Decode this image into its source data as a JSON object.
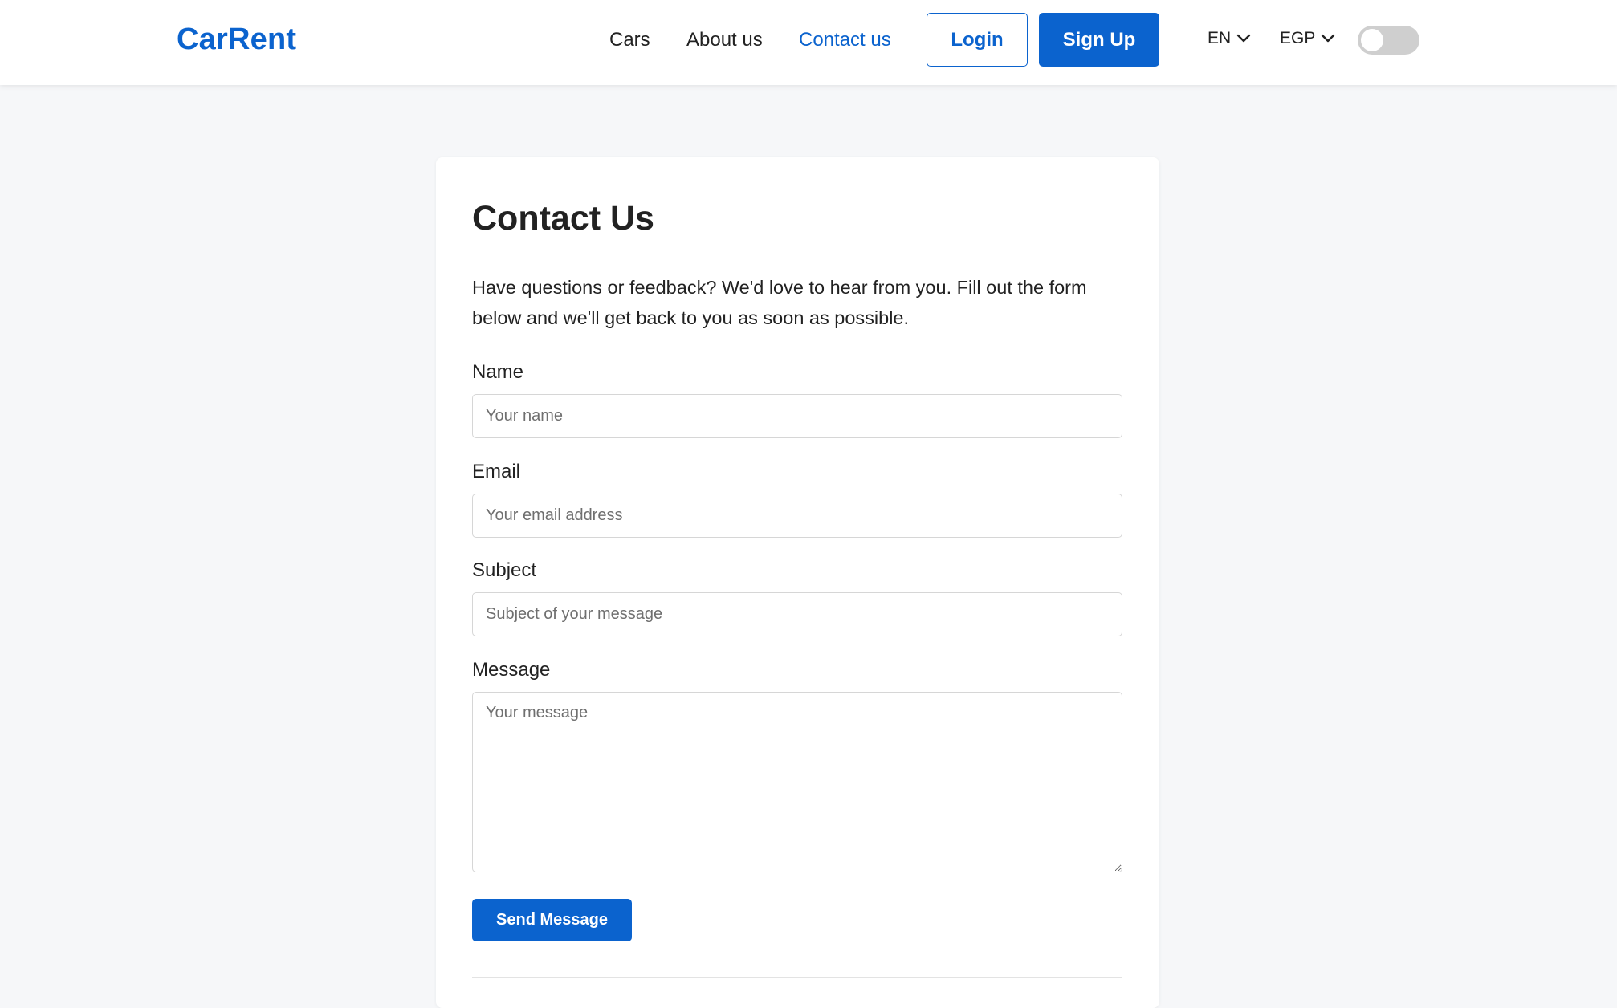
{
  "brand": {
    "name": "CarRent",
    "accent_color": "#0b63ce"
  },
  "nav": {
    "links": [
      {
        "label": "Cars",
        "active": false
      },
      {
        "label": "About us",
        "active": false
      },
      {
        "label": "Contact us",
        "active": true
      }
    ],
    "login_label": "Login",
    "signup_label": "Sign Up",
    "language": {
      "selected": "EN",
      "icon": "chevron-down-icon"
    },
    "currency": {
      "selected": "EGP",
      "icon": "chevron-down-icon"
    },
    "theme_toggle": {
      "on": false
    }
  },
  "contact": {
    "title": "Contact Us",
    "intro": "Have questions or feedback? We'd love to hear from you. Fill out the form below and we'll get back to you as soon as possible.",
    "fields": {
      "name": {
        "label": "Name",
        "placeholder": "Your name",
        "value": ""
      },
      "email": {
        "label": "Email",
        "placeholder": "Your email address",
        "value": ""
      },
      "subject": {
        "label": "Subject",
        "placeholder": "Subject of your message",
        "value": ""
      },
      "message": {
        "label": "Message",
        "placeholder": "Your message",
        "value": ""
      }
    },
    "submit_label": "Send Message"
  },
  "colors": {
    "page_background": "#f6f7f9",
    "primary": "#0b63ce",
    "text": "#222222"
  }
}
